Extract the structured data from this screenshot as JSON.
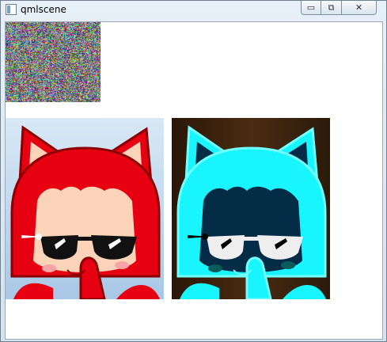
{
  "window": {
    "title": "qmlscene",
    "title_icon": "app-window-icon",
    "controls": [
      {
        "name": "minimize",
        "icon": "minimize-icon",
        "glyph": "▭"
      },
      {
        "name": "maximize",
        "icon": "maximize-icon",
        "glyph": "⧉"
      },
      {
        "name": "close",
        "icon": "close-icon",
        "glyph": "✕"
      }
    ]
  },
  "content": {
    "noise_image": {
      "description_icon": "noise-texture"
    },
    "original_image": {
      "palette": {
        "fur": "#e60012",
        "background": "#bcd7ee"
      }
    },
    "inverted_image": {
      "palette": {
        "fur": "#19f5ff",
        "background": "#3b2412"
      }
    }
  }
}
